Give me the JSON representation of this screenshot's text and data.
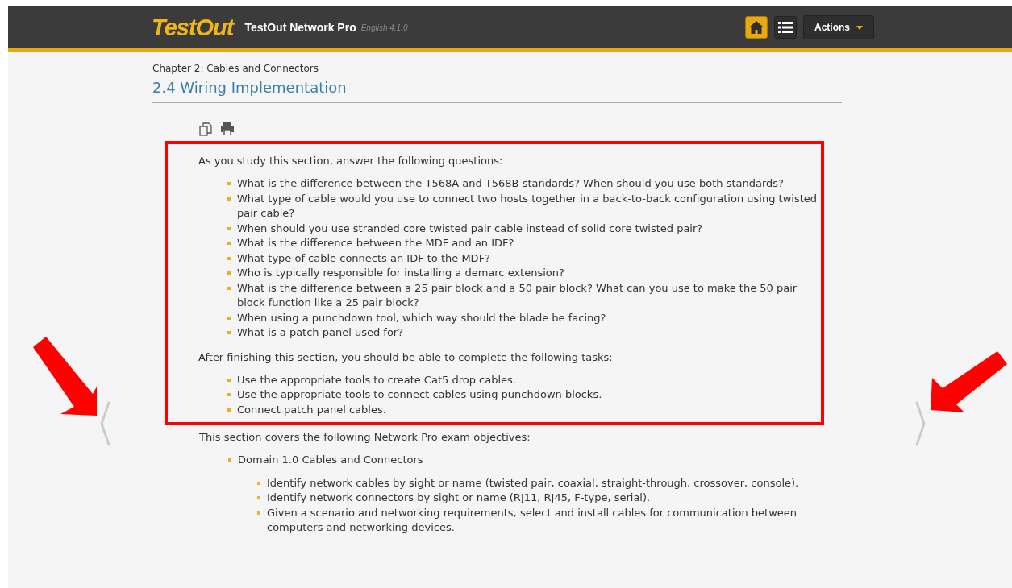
{
  "header": {
    "logo": "TestOut",
    "product": "TestOut Network Pro",
    "version": "English 4.1.0",
    "actions": "Actions"
  },
  "breadcrumb": "Chapter 2: Cables and Connectors",
  "title": "2.4 Wiring Implementation",
  "highlighted": {
    "questions_intro": "As you study this section, answer the following questions:",
    "questions": [
      "What is the difference between the T568A and T568B standards? When should you use both standards?",
      "What type of cable would you use to connect two hosts together in a back-to-back configuration using twisted pair cable?",
      "When should you use stranded core twisted pair cable instead of solid core twisted pair?",
      "What is the difference between the MDF and an IDF?",
      "What type of cable connects an IDF to the MDF?",
      "Who is typically responsible for installing a demarc extension?",
      "What is the difference between a 25 pair block and a 50 pair block? What can you use to make the 50 pair block function like a 25 pair block?",
      "When using a punchdown tool, which way should the blade be facing?",
      "What is a patch panel used for?"
    ],
    "tasks_intro": "After finishing this section, you should be able to complete the following tasks:",
    "tasks": [
      "Use the appropriate tools to create Cat5 drop cables.",
      "Use the appropriate tools to connect cables using punchdown blocks.",
      "Connect patch panel cables."
    ]
  },
  "objectives_intro": "This section covers the following Network Pro exam objectives:",
  "objectives": [
    {
      "text": "Domain 1.0 Cables and Connectors",
      "children": [
        {
          "text": "Identify network cables by sight or name (twisted pair, coaxial, straight-through, crossover, console)."
        },
        {
          "text": "Identify network connectors by sight or name (RJ11, RJ45, F-type, serial)."
        },
        {
          "text": "Given a scenario and networking requirements, select and install cables for communication between computers and networking devices."
        }
      ]
    }
  ]
}
